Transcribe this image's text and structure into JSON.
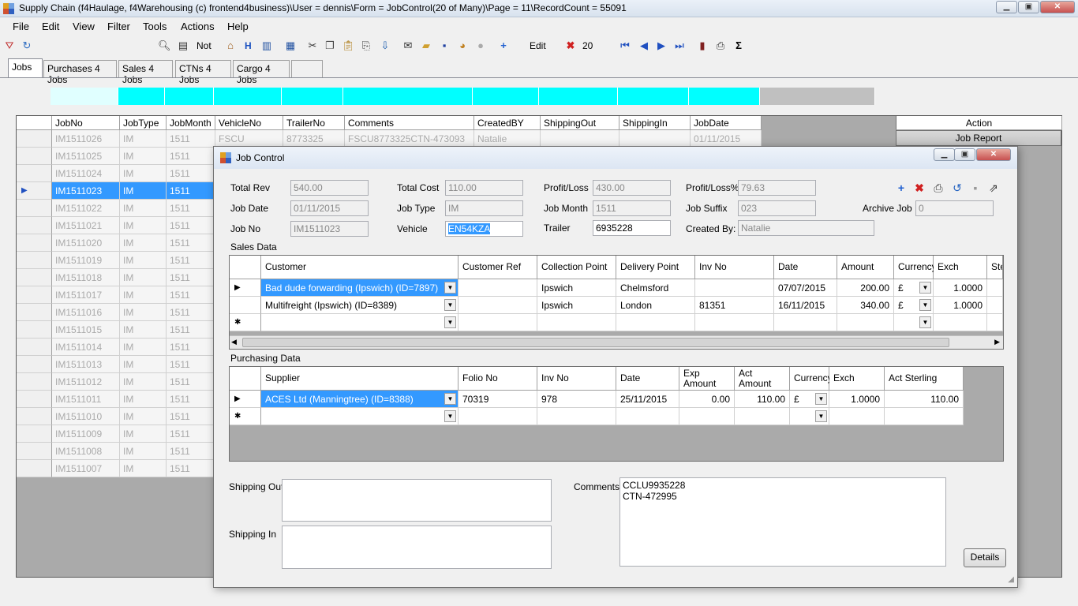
{
  "window": {
    "title": "Supply Chain (f4Haulage, f4Warehousing (c) frontend4business)\\User = dennis\\Form = JobControl(20 of Many)\\Page = 11\\RecordCount = 55091"
  },
  "menu": [
    "File",
    "Edit",
    "View",
    "Filter",
    "Tools",
    "Actions",
    "Help"
  ],
  "toolbar": {
    "not_label": "Not",
    "h_label": "H",
    "edit_label": "Edit",
    "count": "20"
  },
  "tabs": [
    "Jobs",
    "Purchases 4 Jobs",
    "Sales 4 Jobs",
    "CTNs 4 Jobs",
    "Cargo 4 Jobs",
    ""
  ],
  "grid": {
    "columns": [
      "JobNo",
      "JobType",
      "JobMonth",
      "VehicleNo",
      "TrailerNo",
      "Comments",
      "CreatedBY",
      "ShippingOut",
      "ShippingIn",
      "JobDate"
    ],
    "action_header": "Action",
    "action_button": "Job Report",
    "first_row": {
      "jobno": "IM1511026",
      "type": "IM",
      "month": "1511",
      "vehicle": "FSCU",
      "trailer": "8773325",
      "comments": "FSCU8773325CTN-473093",
      "created": "Natalie",
      "date": "01/11/2015"
    },
    "rows": [
      {
        "jobno": "IM1511025",
        "type": "IM",
        "month": "1511"
      },
      {
        "jobno": "IM1511024",
        "type": "IM",
        "month": "1511"
      },
      {
        "jobno": "IM1511023",
        "type": "IM",
        "month": "1511",
        "selected": true
      },
      {
        "jobno": "IM1511022",
        "type": "IM",
        "month": "1511"
      },
      {
        "jobno": "IM1511021",
        "type": "IM",
        "month": "1511"
      },
      {
        "jobno": "IM1511020",
        "type": "IM",
        "month": "1511"
      },
      {
        "jobno": "IM1511019",
        "type": "IM",
        "month": "1511"
      },
      {
        "jobno": "IM1511018",
        "type": "IM",
        "month": "1511"
      },
      {
        "jobno": "IM1511017",
        "type": "IM",
        "month": "1511"
      },
      {
        "jobno": "IM1511016",
        "type": "IM",
        "month": "1511"
      },
      {
        "jobno": "IM1511015",
        "type": "IM",
        "month": "1511"
      },
      {
        "jobno": "IM1511014",
        "type": "IM",
        "month": "1511"
      },
      {
        "jobno": "IM1511013",
        "type": "IM",
        "month": "1511"
      },
      {
        "jobno": "IM1511012",
        "type": "IM",
        "month": "1511"
      },
      {
        "jobno": "IM1511011",
        "type": "IM",
        "month": "1511"
      },
      {
        "jobno": "IM1511010",
        "type": "IM",
        "month": "1511"
      },
      {
        "jobno": "IM1511009",
        "type": "IM",
        "month": "1511"
      },
      {
        "jobno": "IM1511008",
        "type": "IM",
        "month": "1511"
      },
      {
        "jobno": "IM1511007",
        "type": "IM",
        "month": "1511"
      }
    ]
  },
  "dialog": {
    "title": "Job Control",
    "labels": {
      "total_rev": "Total Rev",
      "total_cost": "Total Cost",
      "profit_loss": "Profit/Loss",
      "profit_loss_pct": "Profit/Loss%",
      "job_date": "Job Date",
      "job_type": "Job Type",
      "job_month": "Job Month",
      "job_suffix": "Job Suffix",
      "archive_job": "Archive Job",
      "job_no": "Job No",
      "vehicle": "Vehicle",
      "trailer": "Trailer",
      "created_by": "Created By:",
      "sales_data": "Sales Data",
      "purchasing_data": "Purchasing Data",
      "shipping_out": "Shipping Out",
      "shipping_in": "Shipping In",
      "comments": "Comments"
    },
    "values": {
      "total_rev": "540.00",
      "total_cost": "110.00",
      "profit_loss": "430.00",
      "profit_loss_pct": "79.63",
      "job_date": "01/11/2015",
      "job_type": "IM",
      "job_month": "1511",
      "job_suffix": "023",
      "archive_job": "0",
      "job_no": "IM1511023",
      "vehicle": "EN54KZA",
      "trailer": "6935228",
      "created_by": "Natalie",
      "comments": "CCLU9935228\nCTN-472995",
      "shipping_out": "",
      "shipping_in": ""
    },
    "details_button": "Details",
    "sales": {
      "columns": [
        "Customer",
        "Customer Ref",
        "Collection Point",
        "Delivery Point",
        "Inv No",
        "Date",
        "Amount",
        "Currency",
        "Exch",
        "Ste"
      ],
      "rows": [
        {
          "customer": "Bad dude forwarding (Ipswich) (ID=7897)",
          "ref": "",
          "collection": "Ipswich",
          "delivery": "Chelmsford",
          "inv": "",
          "date": "07/07/2015",
          "amount": "200.00",
          "currency": "£",
          "exch": "1.0000"
        },
        {
          "customer": "Multifreight (Ipswich) (ID=8389)",
          "ref": "",
          "collection": "Ipswich",
          "delivery": "London",
          "inv": "81351",
          "date": "16/11/2015",
          "amount": "340.00",
          "currency": "£",
          "exch": "1.0000"
        }
      ]
    },
    "purchasing": {
      "columns": [
        "Supplier",
        "Folio No",
        "Inv No",
        "Date",
        "Exp Amount",
        "Act Amount",
        "Currency",
        "Exch",
        "Act Sterling"
      ],
      "rows": [
        {
          "supplier": "ACES Ltd (Manningtree) (ID=8388)",
          "folio": "70319",
          "inv": "978",
          "date": "25/11/2015",
          "exp": "0.00",
          "act": "110.00",
          "currency": "£",
          "exch": "1.0000",
          "sterling": "110.00"
        }
      ]
    }
  }
}
